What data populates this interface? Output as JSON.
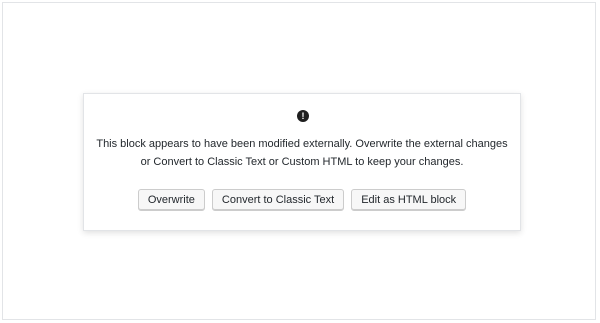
{
  "warning": {
    "icon": "exclamation-circle-icon",
    "icon_glyph": "!",
    "message": "This block appears to have been modified externally. Overwrite the external changes or Convert to Classic Text or Custom HTML to keep your changes."
  },
  "actions": {
    "overwrite_label": "Overwrite",
    "convert_label": "Convert to Classic Text",
    "edit_html_label": "Edit as HTML block"
  },
  "colors": {
    "text": "#23282d",
    "button_bg": "#f7f7f7",
    "button_border": "#cccccc",
    "border": "#e2e4e7"
  }
}
